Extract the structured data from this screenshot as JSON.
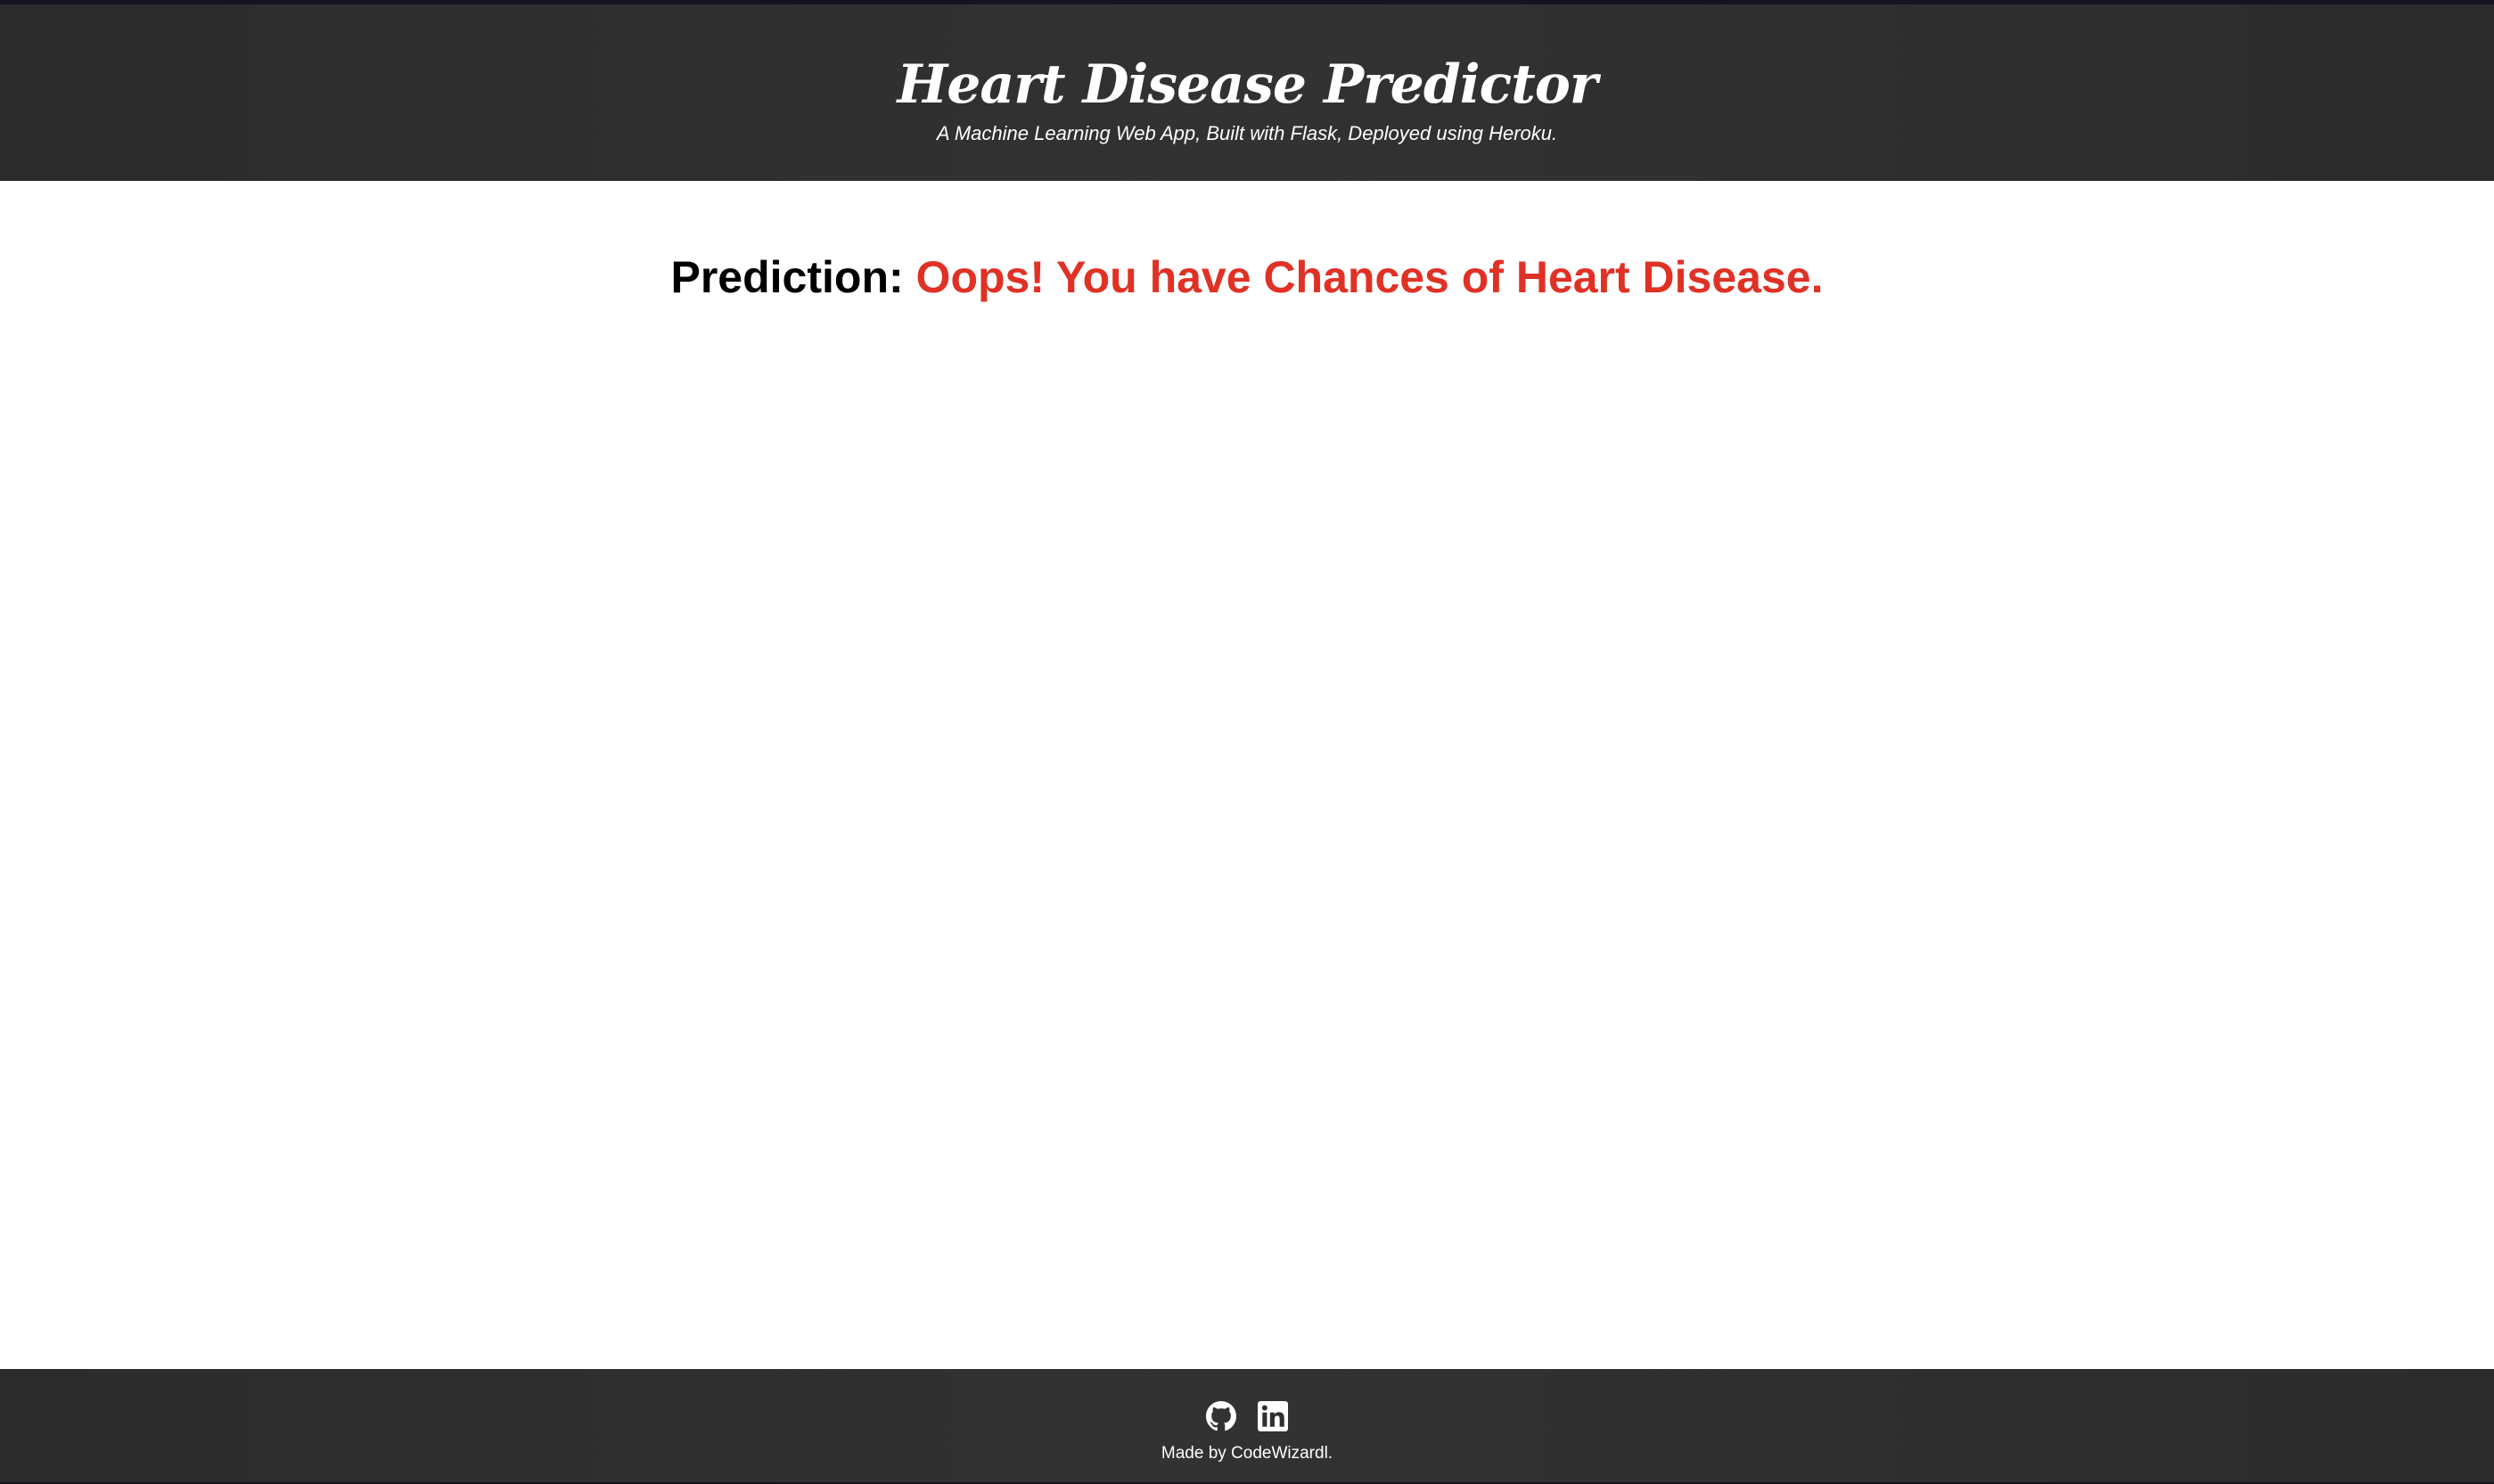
{
  "header": {
    "title": "Heart Disease Predictor",
    "subtitle": "A Machine Learning Web App, Built with Flask, Deployed using Heroku."
  },
  "main": {
    "prediction_label": "Prediction:",
    "prediction_result": "Oops! You have Chances of Heart Disease."
  },
  "footer": {
    "social": [
      {
        "icon": "github-icon"
      },
      {
        "icon": "linkedin-icon"
      }
    ],
    "credit": "Made by CodeWizardl."
  },
  "colors": {
    "header_bg": "#2f2e2f",
    "result_red": "#e03125",
    "text_white": "#ffffff"
  }
}
